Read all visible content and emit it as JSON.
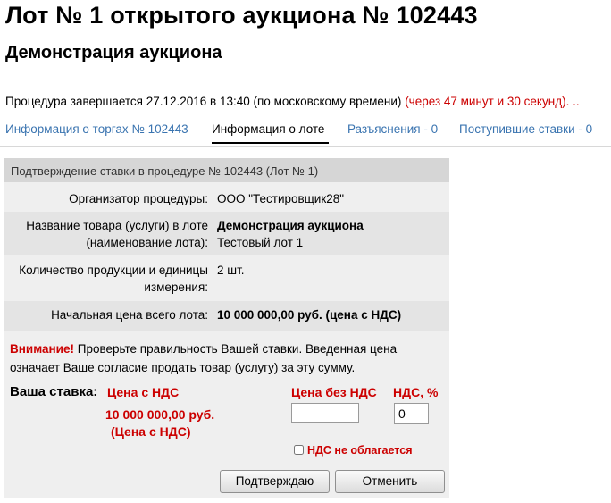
{
  "page": {
    "title": "Лот № 1 открытого аукциона № 102443",
    "subtitle": "Демонстрация аукциона",
    "deadline_prefix": "Процедура завершается 27.12.2016 в 13:40 (по московскому времени)",
    "deadline_remaining": "(через 47 минут и 30 секунд). .."
  },
  "tabs": [
    {
      "label": "Информация о торгах № 102443"
    },
    {
      "label": "Информация о лоте"
    },
    {
      "label": "Разъяснения - 0"
    },
    {
      "label": "Поступившие ставки - 0"
    }
  ],
  "panel": {
    "header": "Подтверждение ставки в процедуре № 102443 (Лот № 1)",
    "rows": [
      {
        "label": "Организатор процедуры:",
        "value": "ООО \"Тестировщик28\""
      },
      {
        "label1": "Название товара (услуги) в лоте",
        "label2": "(наименование лота):",
        "value1": "Демонстрация аукциона",
        "value2": "Тестовый лот 1"
      },
      {
        "label1": "Количество продукции и единицы",
        "label2": "измерения:",
        "value": "2 шт."
      },
      {
        "label": "Начальная цена всего лота:",
        "value": "10 000 000,00 руб. (цена с НДС)"
      }
    ]
  },
  "warning": {
    "title": "Внимание!",
    "text": "Проверьте правильность Вашей ставки. Введенная цена означает Ваше согласие продать товар (услугу) за эту сумму."
  },
  "bid": {
    "label": "Ваша ставка:",
    "price_head": "Цена с НДС",
    "price_value": "10 000 000,00 руб.",
    "price_note": "(Цена с НДС)",
    "no_vat_head": "Цена без НДС",
    "vat_pct_head": "НДС, %",
    "no_vat_value": "",
    "vat_pct_value": "0",
    "no_vat_check_label": "НДС не облагается"
  },
  "buttons": {
    "confirm": "Подтверждаю",
    "cancel": "Отменить"
  },
  "colors": {
    "link": "#3a74b0",
    "alert": "#cc0000",
    "panel_header": "#d6d6d6"
  }
}
